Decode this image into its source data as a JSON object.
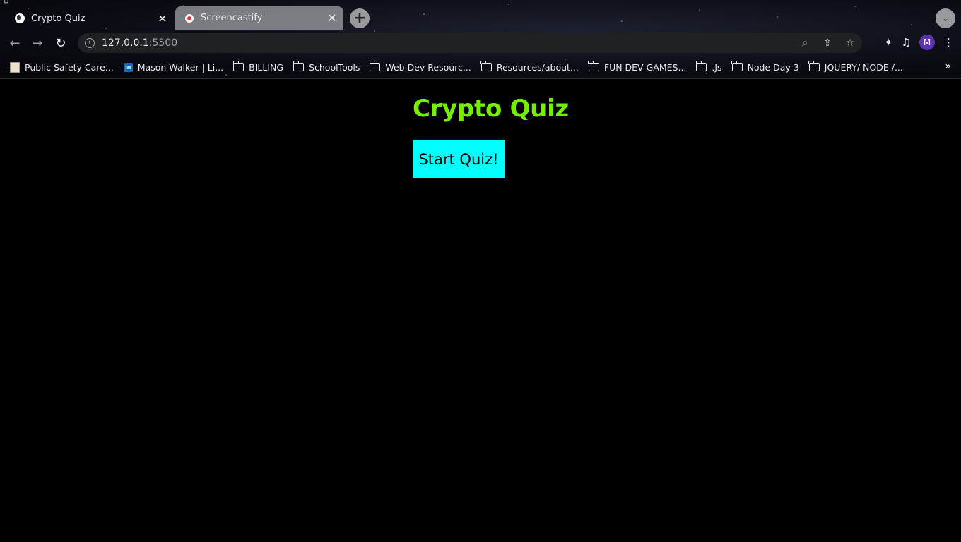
{
  "browser": {
    "tabs": [
      {
        "title": "Crypto Quiz",
        "favicon": "globe-icon",
        "active": true
      },
      {
        "title": "Screencastify",
        "favicon": "screencastify-icon",
        "active": false
      }
    ],
    "new_tab_label": "+",
    "url": {
      "host": "127.0.0.1",
      "port": ":5500"
    },
    "profile_initial": "M",
    "bookmarks": [
      {
        "label": "Public Safety Care...",
        "icon": "document-icon"
      },
      {
        "label": "Mason Walker | Li...",
        "icon": "linkedin-icon"
      },
      {
        "label": "BILLING",
        "icon": "folder-icon"
      },
      {
        "label": "SchoolTools",
        "icon": "folder-icon"
      },
      {
        "label": "Web Dev Resourc...",
        "icon": "folder-icon"
      },
      {
        "label": "Resources/about...",
        "icon": "folder-icon"
      },
      {
        "label": "FUN DEV GAMES...",
        "icon": "folder-icon"
      },
      {
        "label": ".Js",
        "icon": "folder-icon"
      },
      {
        "label": "Node Day 3",
        "icon": "folder-icon"
      },
      {
        "label": "JQUERY/ NODE /...",
        "icon": "folder-icon"
      }
    ],
    "bookmarks_overflow": "»"
  },
  "page": {
    "title": "Crypto Quiz",
    "start_button_label": "Start Quiz!"
  },
  "colors": {
    "title": "#76ee00",
    "start_button_bg": "#00ffff",
    "page_bg": "#000000"
  }
}
